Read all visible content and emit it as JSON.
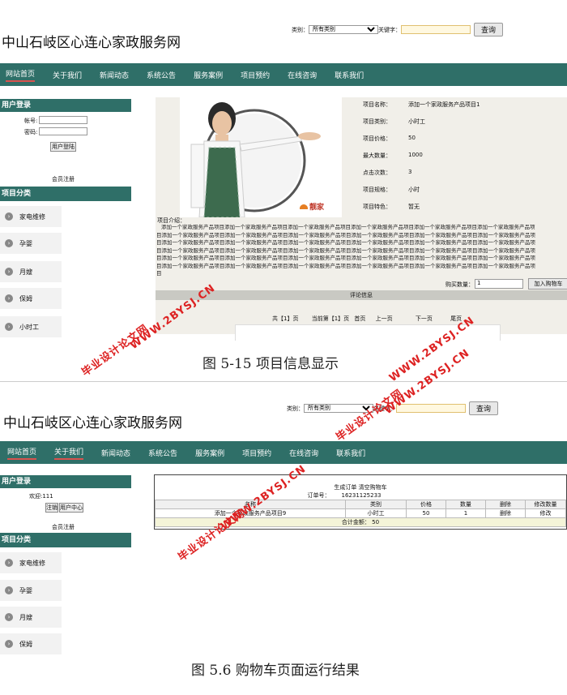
{
  "fig1": {
    "site_title": "中山石岐区心连心家政服务网",
    "search": {
      "category_label": "类别：",
      "category_value": "所有类别",
      "keyword_label": "关键字：",
      "button": "查询"
    },
    "nav": [
      "网站首页",
      "关于我们",
      "新闻动态",
      "系统公告",
      "服务案例",
      "项目预约",
      "在线咨询",
      "联系我们"
    ],
    "login": {
      "title": "用户登录",
      "account_label": "帐号:",
      "password_label": "密码:",
      "login_button": "用户登陆",
      "register_link": "会员注册"
    },
    "categories": {
      "title": "项目分类",
      "items": [
        "家电维修",
        "孕婴",
        "月嫂",
        "保姆",
        "小时工"
      ]
    },
    "product": {
      "logo_text": "靓家",
      "fields": [
        {
          "label": "项目名称：",
          "value": "添加一个家政服务产品项目1"
        },
        {
          "label": "项目类别：",
          "value": "小时工"
        },
        {
          "label": "项目价格：",
          "value": "50"
        },
        {
          "label": "最大数量：",
          "value": "1000"
        },
        {
          "label": "点击次数：",
          "value": "3"
        },
        {
          "label": "项目规格：",
          "value": "小时"
        },
        {
          "label": "项目特色：",
          "value": "暂无"
        }
      ],
      "intro_label": "项目介绍：",
      "intro_lines": [
        "添加一个家政服务产品项目添加一个家政服务产品项目添加一个家政服务产品项目添加一个家政服务产品项目添加一个家政服务产品项目添加一个家政服务产品项",
        "目添加一个家政服务产品项目添加一个家政服务产品项目添加一个家政服务产品项目添加一个家政服务产品项目添加一个家政服务产品项目添加一个家政服务产品项",
        "目添加一个家政服务产品项目添加一个家政服务产品项目添加一个家政服务产品项目添加一个家政服务产品项目添加一个家政服务产品项目添加一个家政服务产品项",
        "目添加一个家政服务产品项目添加一个家政服务产品项目添加一个家政服务产品项目添加一个家政服务产品项目添加一个家政服务产品项目添加一个家政服务产品项",
        "目添加一个家政服务产品项目添加一个家政服务产品项目添加一个家政服务产品项目添加一个家政服务产品项目添加一个家政服务产品项目添加一个家政服务产品项",
        "目添加一个家政服务产品项目添加一个家政服务产品项目添加一个家政服务产品项目添加一个家政服务产品项目添加一个家政服务产品项目添加一个家政服务产品项",
        "目"
      ],
      "qty_label": "购买数量：",
      "qty_value": "1",
      "add_cart_button": "加入购物车",
      "comments_bar": "评论信息",
      "pagination": {
        "total": "共【1】页",
        "current": "当前第【1】页",
        "first": "首页",
        "prev": "上一页",
        "next": "下一页",
        "last": "尾页"
      }
    },
    "caption": "图 5-15 项目信息显示"
  },
  "fig2": {
    "site_title": "中山石岐区心连心家政服务网",
    "search": {
      "category_label": "类别：",
      "category_value": "所有类别",
      "keyword_label": "关键字：",
      "button": "查询"
    },
    "nav": [
      "网站首页",
      "关于我们",
      "新闻动态",
      "系统公告",
      "服务案例",
      "项目预约",
      "在线咨询",
      "联系我们"
    ],
    "login": {
      "title": "用户登录",
      "welcome": "欢迎:111",
      "logout_button": "注销",
      "user_center_button": "用户中心",
      "register_link": "会员注册"
    },
    "categories": {
      "title": "项目分类",
      "items": [
        "家电维修",
        "孕婴",
        "月嫂",
        "保姆"
      ]
    },
    "cart": {
      "actions": "生成订单 清空购物车",
      "order_no_label": "订单号：",
      "order_no": "16231125233",
      "headers": [
        "名称",
        "类别",
        "价格",
        "数量",
        "删除",
        "修改数量"
      ],
      "rows": [
        [
          "添加一个家政服务产品项目9",
          "小时工",
          "50",
          "1",
          "删除",
          "修改"
        ]
      ],
      "total": "合计金额： 50"
    },
    "caption": "图  5.6 购物车页面运行结果"
  },
  "watermarks": [
    "毕业设计论文网",
    "WWW.2BYSJ.CN"
  ],
  "colors": {
    "nav_bg": "#2f6f68",
    "watermark": "#dd2222",
    "keyword_input_bg": "#fff8e0"
  }
}
